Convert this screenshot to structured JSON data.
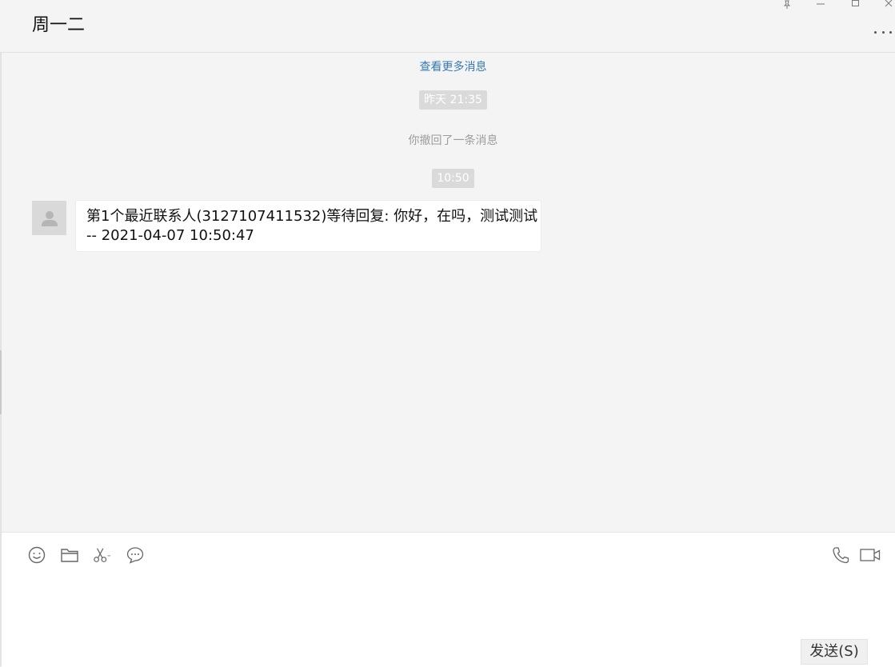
{
  "window": {
    "title": "周一二",
    "controls": [
      "pin-icon",
      "minimize-icon",
      "maximize-icon",
      "close-icon"
    ],
    "more_icon": "more-icon"
  },
  "messages": {
    "view_more": "查看更多消息",
    "timestamp_1": "昨天 21:35",
    "recall_notice": "你撤回了一条消息",
    "timestamp_2": "10:50",
    "incoming": {
      "avatar_icon": "default-avatar-icon",
      "line1": "第1个最近联系人(3127107411532)等待回复: 你好，在吗，测试测试",
      "line2": "-- 2021-04-07 10:50:47"
    }
  },
  "toolbar": {
    "left": [
      "emoji-icon",
      "folder-icon",
      "scissors-icon",
      "chat-bubble-icon"
    ],
    "right": [
      "phone-icon",
      "video-icon"
    ]
  },
  "composer": {
    "value": "",
    "send_label": "发送(S)"
  },
  "colors": {
    "background": "#f4f4f4",
    "link": "#3479b8",
    "time_chip": "#dadada",
    "system_text": "#9d9d9d"
  }
}
